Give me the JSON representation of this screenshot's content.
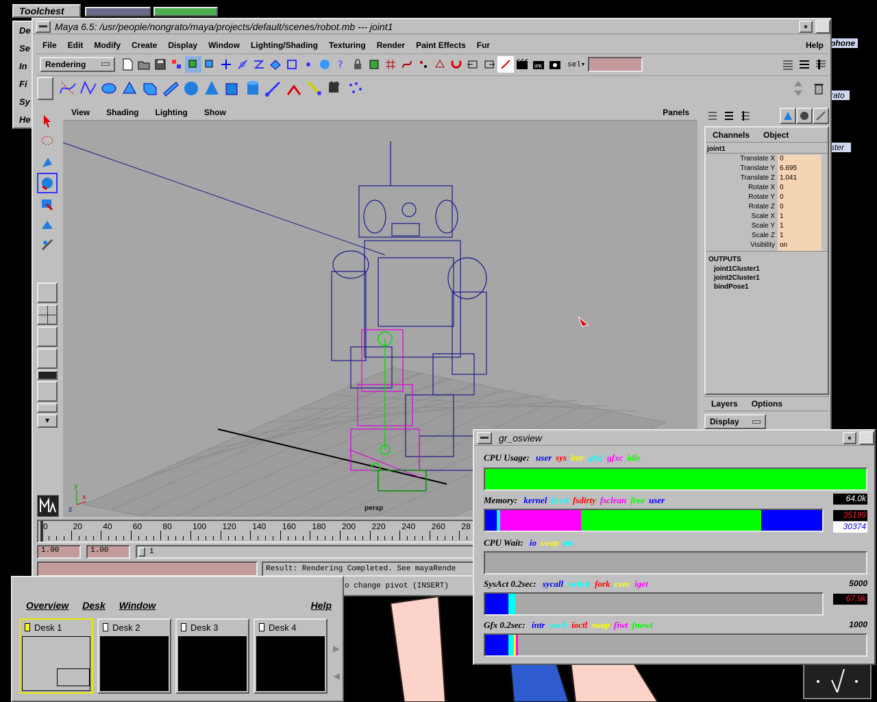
{
  "desktop": {
    "toolchest_title": "Toolchest",
    "toolchest_items": [
      "De",
      "Se",
      "In",
      "Fi",
      "Sy",
      "He"
    ],
    "right_labels": [
      "phone",
      "rato",
      "ster"
    ]
  },
  "maya": {
    "title": "Maya 6.5: /usr/people/nongrato/maya/projects/default/scenes/robot.mb   ---   joint1",
    "menus": [
      "File",
      "Edit",
      "Modify",
      "Create",
      "Display",
      "Window",
      "Lighting/Shading",
      "Texturing",
      "Render",
      "Paint Effects",
      "Fur"
    ],
    "help": "Help",
    "menuset": "Rendering",
    "sel_label": "sel▾",
    "panel_menus": [
      "View",
      "Shading",
      "Lighting",
      "Show"
    ],
    "panels_label": "Panels",
    "camera_label": "persp",
    "channels_tab": "Channels",
    "object_tab": "Object",
    "node_name": "joint1",
    "attributes": [
      {
        "name": "Translate X",
        "value": "0"
      },
      {
        "name": "Translate Y",
        "value": "6.695"
      },
      {
        "name": "Translate Z",
        "value": "1.041"
      },
      {
        "name": "Rotate X",
        "value": "0"
      },
      {
        "name": "Rotate Y",
        "value": "0"
      },
      {
        "name": "Rotate Z",
        "value": "0"
      },
      {
        "name": "Scale X",
        "value": "1"
      },
      {
        "name": "Scale Y",
        "value": "1"
      },
      {
        "name": "Scale Z",
        "value": "1"
      },
      {
        "name": "Visibility",
        "value": "on"
      }
    ],
    "outputs_header": "OUTPUTS",
    "outputs": [
      "joint1Cluster1",
      "joint2Cluster1",
      "bindPose1"
    ],
    "layers_tab": "Layers",
    "options_tab": "Options",
    "display_btn": "Display",
    "timeline_ticks": [
      "0",
      "20",
      "40",
      "60",
      "80",
      "100",
      "120",
      "140",
      "160",
      "180",
      "200",
      "220",
      "240",
      "260",
      "28"
    ],
    "range_start": "1.00",
    "range_start2": "1.00",
    "range_slider_val": "1",
    "result_text": "Result: Rendering Completed. See mayaRende",
    "help_line": "Rotate Tool: Use manipulator to rotate object(s). Use edit mode to change pivot (INSERT)"
  },
  "osview": {
    "title": "gr_osview",
    "cpu_label": "CPU Usage:",
    "cpu_legend": [
      {
        "t": "user",
        "c": "#0000ff"
      },
      {
        "t": "sys",
        "c": "#ff0000"
      },
      {
        "t": "intr",
        "c": "#ffff00"
      },
      {
        "t": "gfxf",
        "c": "#00ffff"
      },
      {
        "t": "gfxc",
        "c": "#ff00ff"
      },
      {
        "t": "idle",
        "c": "#00ff00"
      }
    ],
    "mem_label": "Memory:",
    "mem_legend": [
      {
        "t": "kernel",
        "c": "#0000ff"
      },
      {
        "t": "fs ctl",
        "c": "#00ffff"
      },
      {
        "t": "fsdirty",
        "c": "#ff0000"
      },
      {
        "t": "fsclean",
        "c": "#ff00ff"
      },
      {
        "t": "free",
        "c": "#00ff00"
      },
      {
        "t": "user",
        "c": "#0000ff"
      }
    ],
    "mem_total": "64.0k",
    "mem_v1": "35199",
    "mem_v2": "30374",
    "wait_label": "CPU Wait:",
    "wait_legend": [
      {
        "t": "io",
        "c": "#0000ff"
      },
      {
        "t": "swap",
        "c": "#ffff00"
      },
      {
        "t": "pio",
        "c": "#00ffff"
      }
    ],
    "sys_label": "SysAct 0.2sec:",
    "sys_legend": [
      {
        "t": "sycall",
        "c": "#0000ff"
      },
      {
        "t": "switch",
        "c": "#00ffff"
      },
      {
        "t": "fork",
        "c": "#ff0000"
      },
      {
        "t": "exec",
        "c": "#ffff00"
      },
      {
        "t": "iget",
        "c": "#ff00ff"
      }
    ],
    "sys_max": "5000",
    "sys_val": "67.9k",
    "gfx_label": "Gfx 0.2sec:",
    "gfx_legend": [
      {
        "t": "intr",
        "c": "#0000ff"
      },
      {
        "t": "swch",
        "c": "#00ffff"
      },
      {
        "t": "ioctl",
        "c": "#ff0000"
      },
      {
        "t": "swap",
        "c": "#ffff00"
      },
      {
        "t": "fiwt",
        "c": "#ff00ff"
      },
      {
        "t": "fnowt",
        "c": "#00ff00"
      }
    ],
    "gfx_max": "1000",
    "cpu_idle_fraction": 1.0,
    "mem_segments": [
      {
        "c": "#0000ff",
        "f": 0.035
      },
      {
        "c": "#00ffff",
        "f": 0.01
      },
      {
        "c": "#ff00ff",
        "f": 0.24
      },
      {
        "c": "#00ff00",
        "f": 0.535
      },
      {
        "c": "#0000ff",
        "f": 0.18
      }
    ]
  },
  "desks": {
    "menus": [
      "Overview",
      "Desk",
      "Window"
    ],
    "help": "Help",
    "items": [
      "Desk 1",
      "Desk 2",
      "Desk 3",
      "Desk 4"
    ]
  }
}
